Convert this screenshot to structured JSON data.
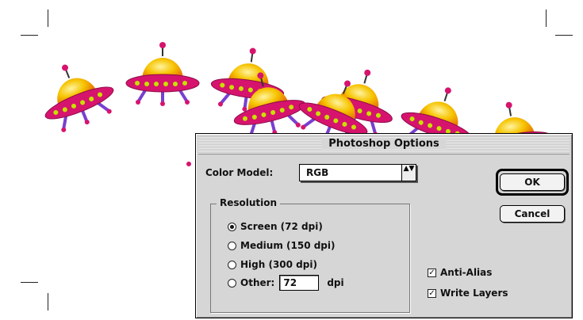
{
  "dialog": {
    "title": "Photoshop Options",
    "color_model_label": "Color Model:",
    "color_model_value": "RGB",
    "resolution_group_label": "Resolution",
    "resolution_options": [
      {
        "label": "Screen (72 dpi)",
        "selected": true
      },
      {
        "label": "Medium (150 dpi)",
        "selected": false
      },
      {
        "label": "High (300 dpi)",
        "selected": false
      },
      {
        "label": "Other:",
        "selected": false
      }
    ],
    "other_value": "72",
    "dpi_unit": "dpi",
    "ok_label": "OK",
    "cancel_label": "Cancel",
    "anti_alias_label": "Anti-Alias",
    "anti_alias_checked": true,
    "write_layers_label": "Write Layers",
    "write_layers_checked": true,
    "check_mark": "✓",
    "popup_arrows": "▲▼"
  },
  "colors": {
    "ufo_body": "#d6146e",
    "ufo_lights": "#c8e000",
    "ufo_dome": "#f6b800",
    "ufo_legs": "#7a3fd0",
    "dialog_bg": "#d6d6d6"
  }
}
